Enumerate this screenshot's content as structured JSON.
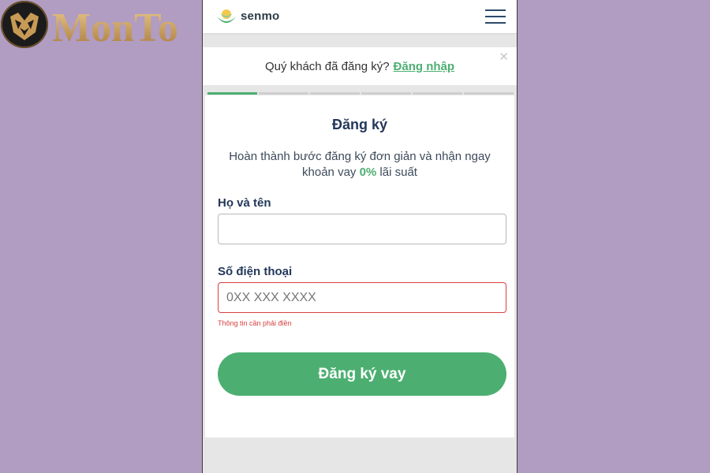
{
  "watermark": {
    "text": "MonTop",
    "icon": "owl-logo-icon"
  },
  "app": {
    "brand": "senmo",
    "brand_icon": "lotus-logo-icon",
    "menu_icon": "hamburger-menu-icon"
  },
  "login_prompt": {
    "text": "Quý khách đã đăng ký?",
    "link": "Đăng nhập",
    "close_icon": "close-icon"
  },
  "progress": {
    "total_steps": 6,
    "current_step": 1
  },
  "form": {
    "title": "Đăng ký",
    "subtitle_pre": "Hoàn thành bước đăng ký đơn giản và nhận ngay khoản vay ",
    "subtitle_rate": "0%",
    "subtitle_post": " lãi suất",
    "name_label": "Họ và tên",
    "name_value": "",
    "phone_label": "Số điện thoại",
    "phone_placeholder": "0XX XXX XXXX",
    "phone_error": "Thông tin cần phải điền",
    "submit": "Đăng ký vay"
  },
  "colors": {
    "accent": "#4caf71",
    "error": "#d84040",
    "heading": "#23385a",
    "background": "#b19cc2"
  }
}
